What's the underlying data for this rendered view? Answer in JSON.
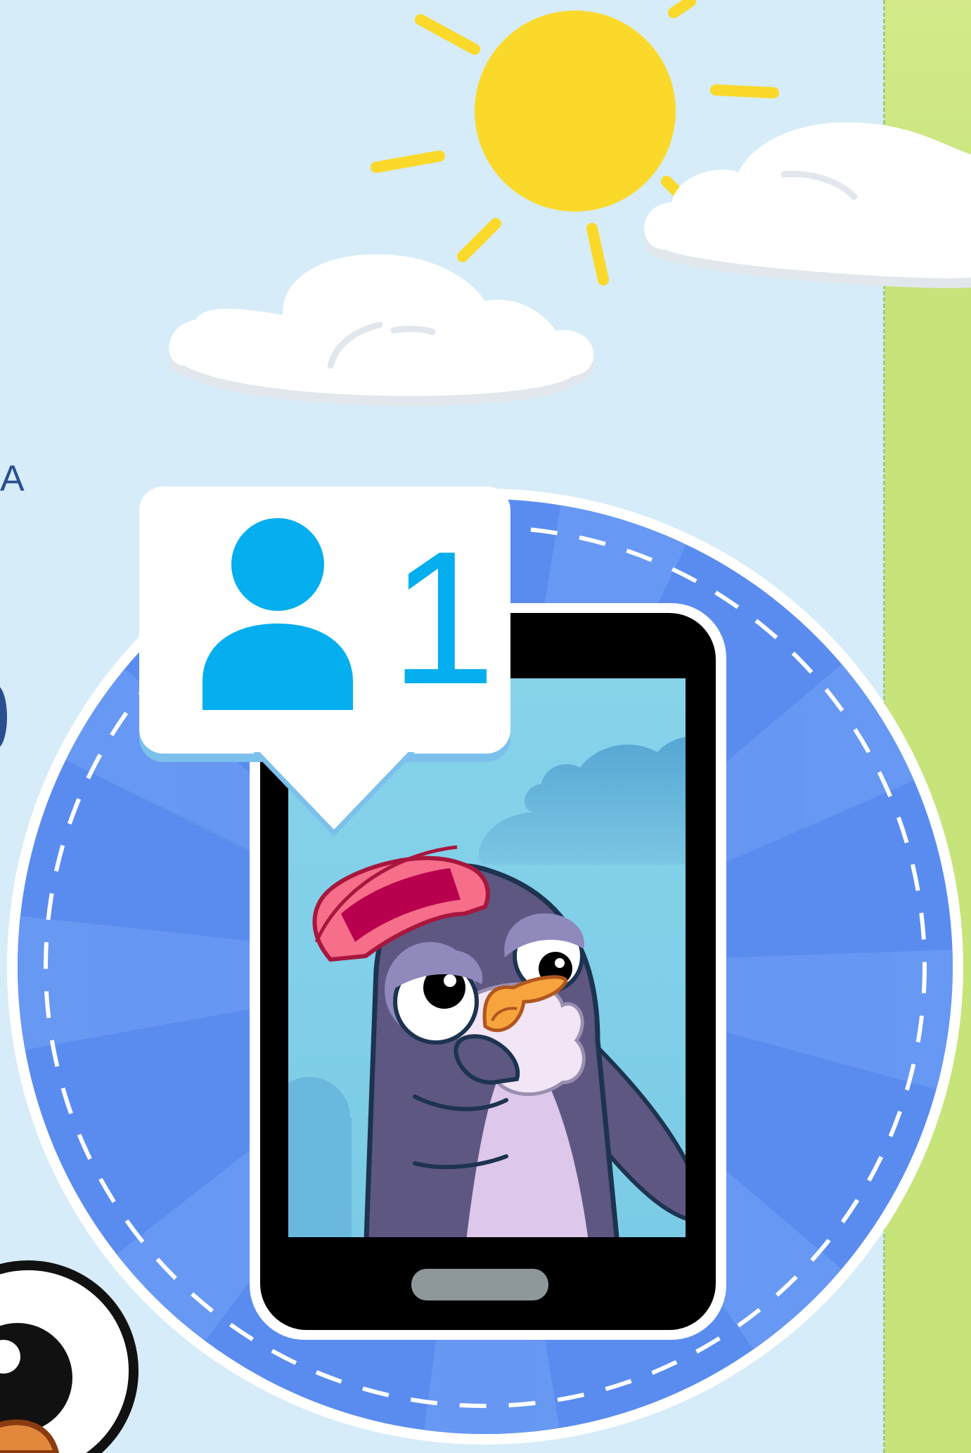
{
  "edge_text": {
    "partial_letter": "A"
  },
  "notification_badge": {
    "icon": "person-icon",
    "count": "1"
  },
  "colors": {
    "sky": "#d6ecf8",
    "sun": "#fbd92a",
    "circle_blue": "#5a8cf0",
    "badge_icon": "#04aeef",
    "green_panel": "#c6e47a",
    "penguin_body": "#5d5782",
    "hat": "#f66e8a"
  }
}
